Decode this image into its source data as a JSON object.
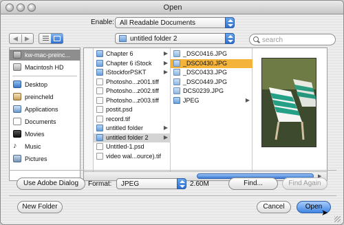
{
  "window": {
    "title": "Open"
  },
  "toolbar": {
    "enable_label": "Enable:",
    "enable_value": "All Readable Documents",
    "location_value": "untitled folder 2",
    "search_placeholder": "search"
  },
  "sidebar": {
    "items": [
      {
        "label": "kw-mac-preinc...",
        "icon": "computer-icon",
        "selected": true
      },
      {
        "label": "Macintosh HD",
        "icon": "hard-drive-icon"
      },
      {
        "label": "Desktop",
        "icon": "desktop-icon"
      },
      {
        "label": "preincheld",
        "icon": "home-icon"
      },
      {
        "label": "Applications",
        "icon": "applications-icon"
      },
      {
        "label": "Documents",
        "icon": "documents-icon"
      },
      {
        "label": "Movies",
        "icon": "movies-icon"
      },
      {
        "label": "Music",
        "icon": "music-icon"
      },
      {
        "label": "Pictures",
        "icon": "pictures-icon"
      }
    ]
  },
  "browser": {
    "column1": [
      {
        "name": "Chapter 6",
        "kind": "folder",
        "arrow": true
      },
      {
        "name": "Chapter 6 iStock",
        "kind": "folder",
        "arrow": true
      },
      {
        "name": "iStockforPSKT",
        "kind": "folder",
        "arrow": true
      },
      {
        "name": "Photosho...z001.tiff",
        "kind": "file"
      },
      {
        "name": "Photosho...z002.tiff",
        "kind": "file"
      },
      {
        "name": "Photosho...z003.tiff",
        "kind": "file"
      },
      {
        "name": "postit.psd",
        "kind": "file"
      },
      {
        "name": "record.tif",
        "kind": "file"
      },
      {
        "name": "untitled folder",
        "kind": "folder",
        "arrow": true
      },
      {
        "name": "untitled folder 2",
        "kind": "folder",
        "arrow": true,
        "selected": true
      },
      {
        "name": "Untitled-1.psd",
        "kind": "file"
      },
      {
        "name": "video wal...ource).tif",
        "kind": "file"
      }
    ],
    "column2": [
      {
        "name": "_DSC0416.JPG",
        "kind": "jpg"
      },
      {
        "name": "_DSC0430.JPG",
        "kind": "jpg",
        "selected": true
      },
      {
        "name": "_DSC0433.JPG",
        "kind": "jpg"
      },
      {
        "name": "_DSC0449.JPG",
        "kind": "jpg"
      },
      {
        "name": "DCS0239.JPG",
        "kind": "jpg"
      },
      {
        "name": "JPEG",
        "kind": "folder",
        "arrow": true
      }
    ]
  },
  "options": {
    "use_adobe_dialog": "Use Adobe Dialog",
    "format_label": "Format:",
    "format_value": "JPEG",
    "file_size": "2.60M",
    "find": "Find...",
    "find_again": "Find Again"
  },
  "footer": {
    "new_folder": "New Folder",
    "cancel": "Cancel",
    "open": "Open"
  }
}
